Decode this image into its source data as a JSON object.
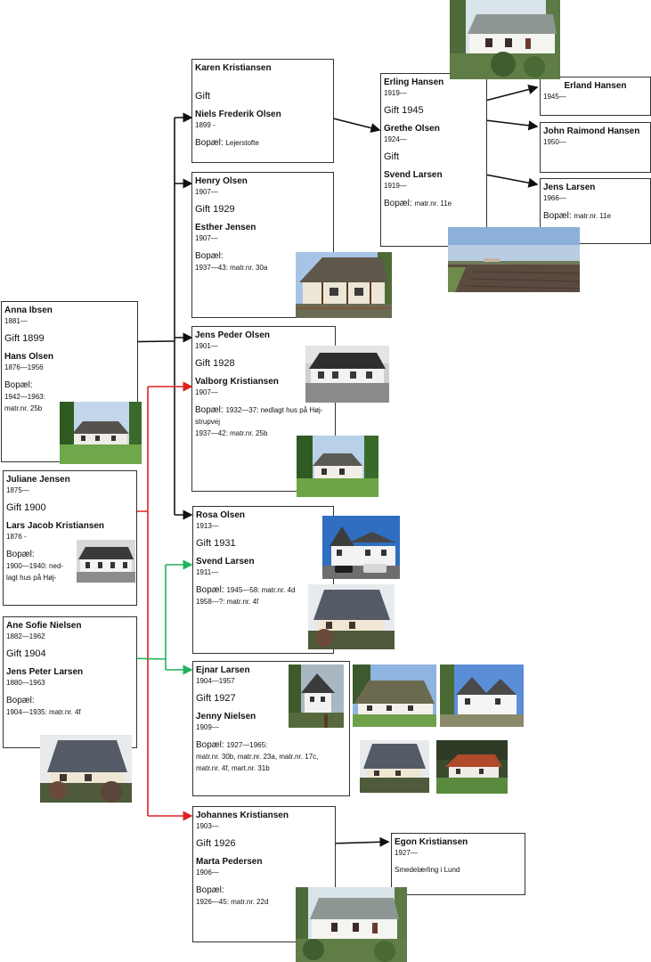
{
  "grandparents": [
    {
      "partner1": {
        "name": "Anna Ibsen",
        "dates": "1881—"
      },
      "marriage": "Gift 1899",
      "partner2": {
        "name": "Hans Olsen",
        "dates": "1876—1956"
      },
      "residence_label": "Bopæl:",
      "residence_lines": [
        "1942—1963:",
        "matr.nr. 25b"
      ]
    },
    {
      "partner1": {
        "name": "Juliane Jensen",
        "dates": "1875—"
      },
      "marriage": "Gift 1900",
      "partner2": {
        "name": "Lars Jacob Kristiansen",
        "dates": "1876 -"
      },
      "residence_label": "Bopæl:",
      "residence_lines": [
        "1900—1940: ned-",
        "lagt hus på Høj-"
      ]
    },
    {
      "partner1": {
        "name": "Ane Sofie Nielsen",
        "dates": "1882—1962"
      },
      "marriage": "Gift 1904",
      "partner2": {
        "name": "Jens Peter Larsen",
        "dates": "1880—1963"
      },
      "residence_label": "Bopæl:",
      "residence_lines": [
        "1904—1935: matr.nr. 4f"
      ]
    }
  ],
  "children": [
    {
      "partner1": {
        "name": "Karen Kristiansen",
        "dates": ""
      },
      "marriage": "Gift",
      "partner2": {
        "name": "Niels Frederik Olsen",
        "dates": "1899 -"
      },
      "residence_label": "Bopæl:",
      "residence_inline": "Lejerstofte"
    },
    {
      "partner1": {
        "name": "Henry Olsen",
        "dates": "1907—"
      },
      "marriage": "Gift 1929",
      "partner2": {
        "name": "Esther Jensen",
        "dates": "1907—"
      },
      "residence_label": "Bopæl:",
      "residence_lines": [
        "1937—43: matr.nr. 30a"
      ]
    },
    {
      "partner1": {
        "name": "Jens Peder Olsen",
        "dates": "1901—"
      },
      "marriage": "Gift 1928",
      "partner2": {
        "name": "Valborg Kristiansen",
        "dates": "1907—"
      },
      "residence_label": "Bopæl:",
      "residence_inline": "1932—37: nedlagt hus på Høj-",
      "residence_lines": [
        "strupvej",
        "1937—42: matr.nr. 25b"
      ]
    },
    {
      "partner1": {
        "name": "Rosa Olsen",
        "dates": "1913—"
      },
      "marriage": "Gift 1931",
      "partner2": {
        "name": "Svend Larsen",
        "dates": "1911—"
      },
      "residence_label": "Bopæl:",
      "residence_inline": "1945—58: matr.nr. 4d",
      "residence_lines": [
        "1958—?: matr.nr. 4f"
      ]
    },
    {
      "partner1": {
        "name": "Ejnar Larsen",
        "dates": "1904—1957"
      },
      "marriage": "Gift 1927",
      "partner2": {
        "name": "Jenny Nielsen",
        "dates": "1909—"
      },
      "residence_label": "Bopæl:",
      "residence_inline": "1927—1965:",
      "residence_lines": [
        "matr.nr. 30b, matr.nr. 23a, matr.nr. 17c,",
        "matr.nr. 4f, mart.nr. 31b"
      ]
    },
    {
      "partner1": {
        "name": "Johannes Kristiansen",
        "dates": "1903—"
      },
      "marriage": "Gift 1926",
      "partner2": {
        "name": "Marta Pedersen",
        "dates": "1906—"
      },
      "residence_label": "Bopæl:",
      "residence_lines": [
        "1926—45: matr.nr. 22d"
      ]
    }
  ],
  "third_generation": {
    "partner1": {
      "name": "Erling Hansen",
      "dates": "1919—"
    },
    "marriage1": "Gift 1945",
    "partner2": {
      "name": "Grethe Olsen",
      "dates": "1924—"
    },
    "marriage2": "Gift",
    "partner3": {
      "name": "Svend Larsen",
      "dates": "1919—"
    },
    "residence_label": "Bopæl:",
    "residence_inline": "matr.nr. 11e"
  },
  "descendants": [
    {
      "name": "Erland Hansen",
      "dates": "1945—"
    },
    {
      "name": "John Raimond Hansen",
      "dates": "1950—"
    },
    {
      "name": "Jens Larsen",
      "dates": "1966—",
      "residence_label": "Bopæl:",
      "residence_inline": "matr.nr. 11e"
    },
    {
      "name": "Egon Kristiansen",
      "dates": "1927—",
      "note": "Smedelærling i Lund"
    }
  ],
  "colors": {
    "line_black": "#111111",
    "line_red": "#e02020",
    "line_green": "#1fb45a"
  },
  "photos": [
    "white-house-photo",
    "thatched-cottage-photo",
    "bw-cottage-photo",
    "garden-cottage-photo",
    "farmhouse-photo",
    "bw-house-photo",
    "gray-roof-house-photo",
    "white-villa-photo",
    "brick-house-photo",
    "field-photo",
    "thatched-house-photo"
  ]
}
